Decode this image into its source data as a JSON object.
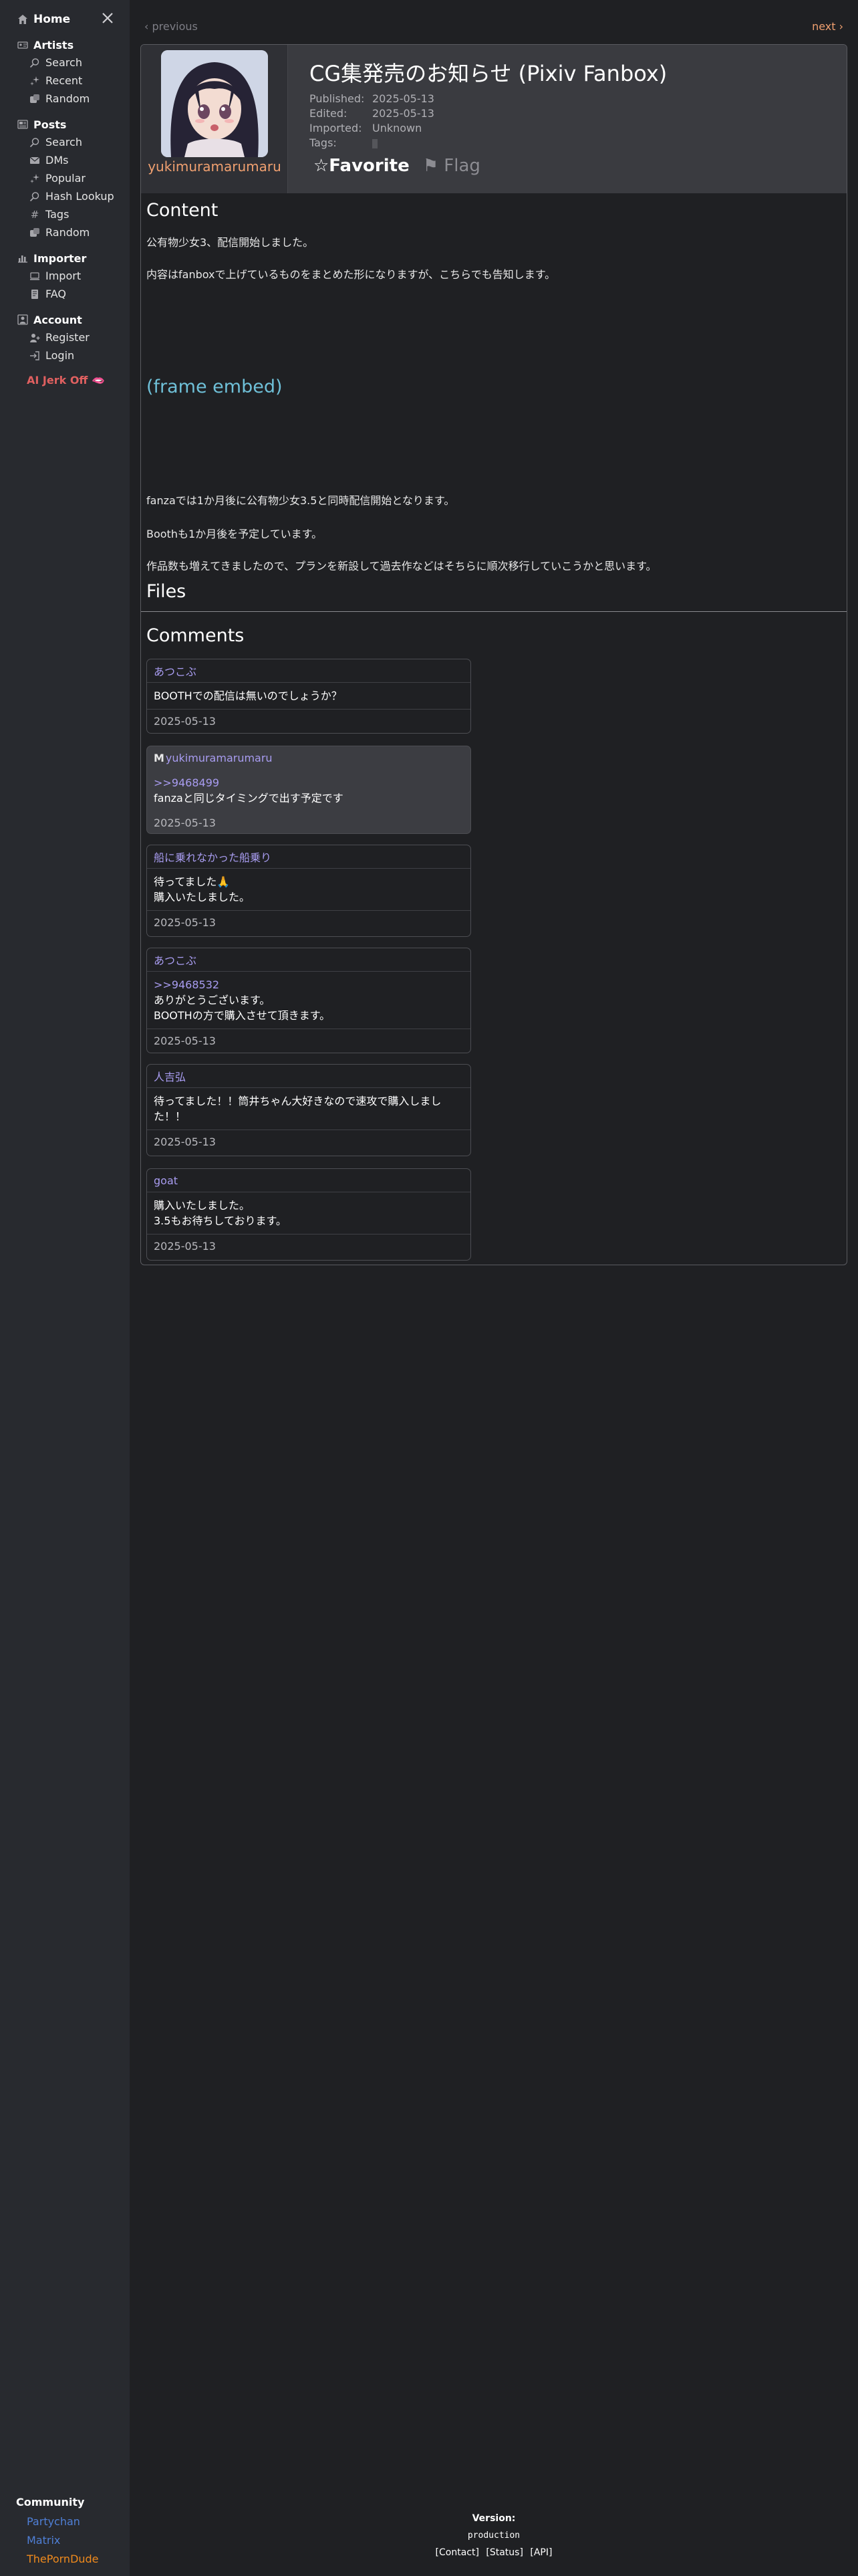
{
  "sidebar": {
    "home": "Home",
    "sections": {
      "artists": {
        "title": "Artists",
        "items": [
          "Search",
          "Recent",
          "Random"
        ]
      },
      "posts": {
        "title": "Posts",
        "items": [
          "Search",
          "DMs",
          "Popular",
          "Hash Lookup",
          "Tags",
          "Random"
        ]
      },
      "importer": {
        "title": "Importer",
        "items": [
          "Import",
          "FAQ"
        ]
      },
      "account": {
        "title": "Account",
        "items": [
          "Register",
          "Login"
        ]
      }
    },
    "jerk": "AI Jerk Off 🫦",
    "community": {
      "title": "Community",
      "links": [
        "Partychan",
        "Matrix",
        "ThePornDude"
      ],
      "colors": [
        "#4f7fd6",
        "#4f7fd6",
        "#f08a1c"
      ]
    }
  },
  "nav": {
    "previous": "‹ previous",
    "next": "next ›"
  },
  "post": {
    "artist": "yukimuramarumaru",
    "title": "CG集発売のお知らせ (Pixiv Fanbox)",
    "meta": {
      "published_label": "Published:",
      "published": "2025-05-13",
      "edited_label": "Edited:",
      "edited": "2025-05-13",
      "imported_label": "Imported:",
      "imported": "Unknown",
      "tags_label": "Tags:"
    },
    "favorite": "☆Favorite",
    "flag": "⚑ Flag"
  },
  "content": {
    "heading": "Content",
    "p1": "公有物少女3、配信開始しました。",
    "p2": "内容はfanboxで上げているものをまとめた形になりますが、こちらでも告知します。",
    "embed": "(frame embed)",
    "p3": "fanzaでは1か月後に公有物少女3.5と同時配信開始となります。",
    "p4": "Boothも1か月後を予定しています。",
    "p5": "作品数も増えてきましたので、プランを新設して過去作などはそちらに順次移行していこうかと思います。"
  },
  "files": {
    "heading": "Files"
  },
  "comments": {
    "heading": "Comments",
    "list": [
      {
        "author": "あつこぶ",
        "lines": [
          "BOOTHでの配信は無いのでしょうか？"
        ],
        "date": "2025-05-13"
      },
      {
        "author": "yukimuramarumaru",
        "ref": ">>9468499",
        "lines": [
          "fanzaと同じタイミングで出す予定です"
        ],
        "date": "2025-05-13"
      },
      {
        "author": "船に乗れなかった船乗り",
        "lines": [
          "待ってました🙏",
          "購入いたしました。"
        ],
        "date": "2025-05-13"
      },
      {
        "author": "あつこぶ",
        "ref": ">>9468532",
        "lines": [
          "ありがとうございます。",
          "BOOTHの方で購入させて頂きます。"
        ],
        "date": "2025-05-13"
      },
      {
        "author": "人吉弘",
        "lines": [
          "待ってました！！筒井ちゃん大好きなので速攻で購入しました！！"
        ],
        "date": "2025-05-13"
      },
      {
        "author": "goat",
        "lines": [
          "購入いたしました。",
          "3.5もお待ちしております。"
        ],
        "date": "2025-05-13"
      }
    ]
  },
  "footer": {
    "version": "Version:",
    "env": "production",
    "links": [
      "[Contact]",
      "[Status]",
      "[API]"
    ]
  },
  "colors": {
    "accent": "#f0a070",
    "commenter": "#a89cf0",
    "embed": "#6fc0d8",
    "jerk": "#e06060"
  }
}
